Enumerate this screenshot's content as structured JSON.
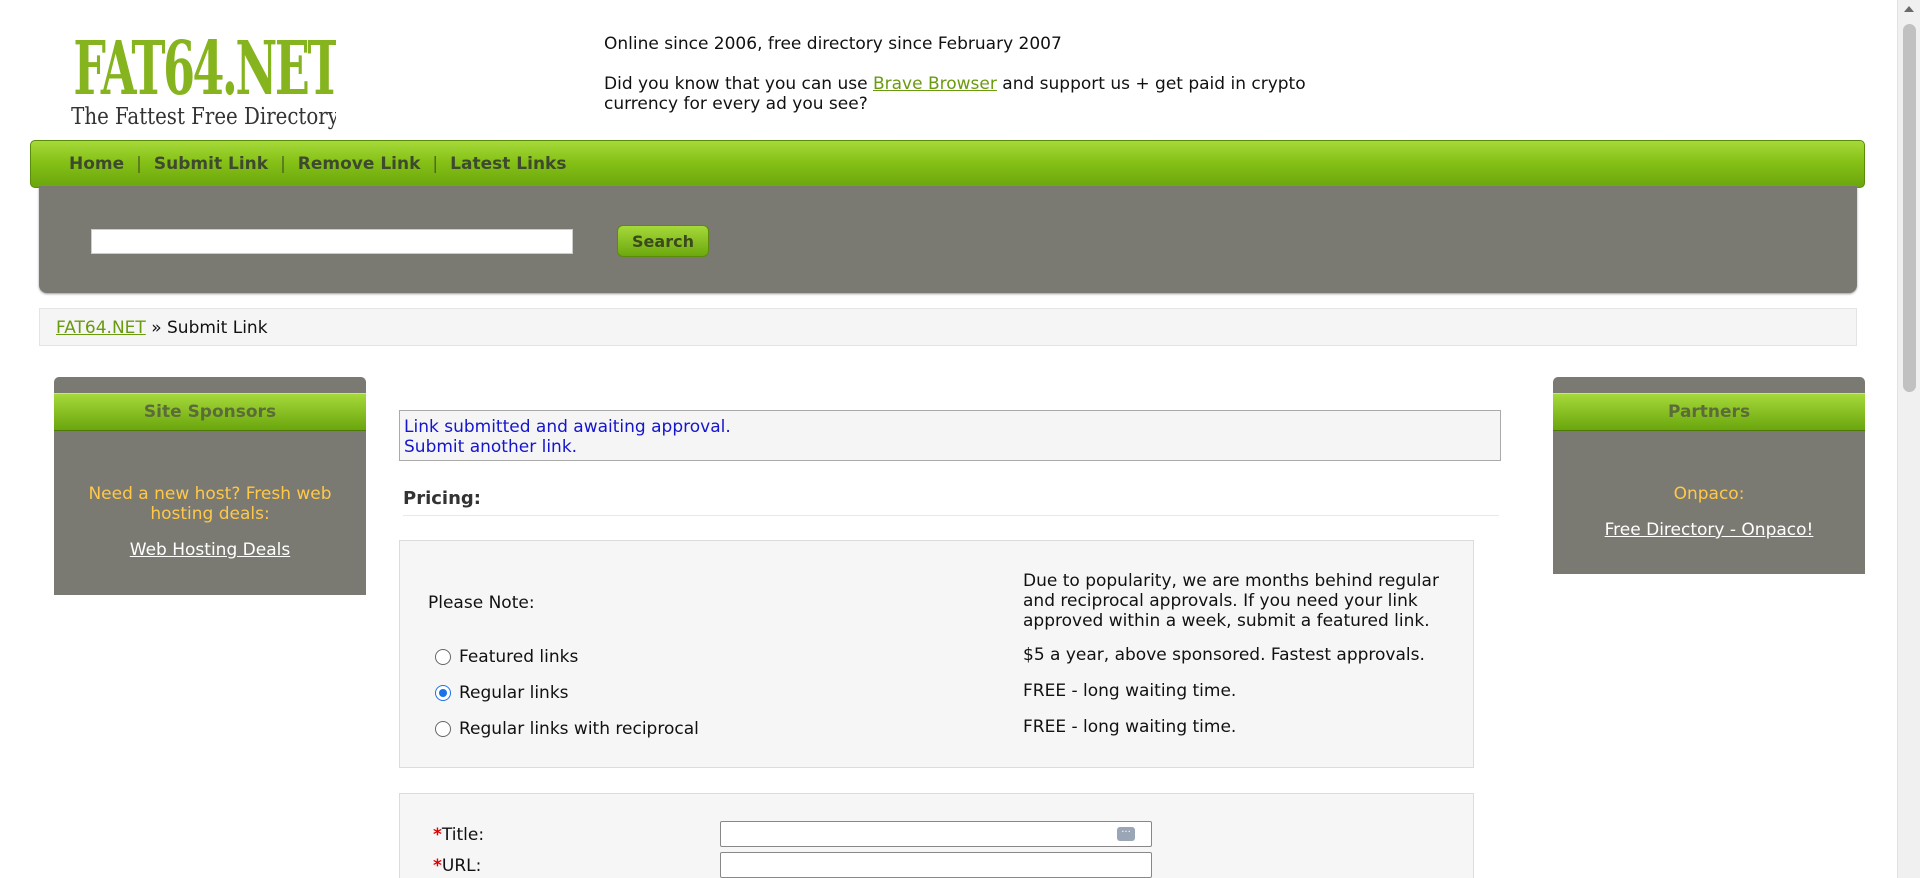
{
  "logo": {
    "text": "FAT64.NET",
    "tagline": "The Fattest Free Directory"
  },
  "header": {
    "line1": "Online since 2006, free directory since February 2007",
    "line2_before": "Did you know that you can use ",
    "line2_link": "Brave Browser",
    "line2_after": " and support us + get paid in crypto currency for every ad you see?"
  },
  "nav": {
    "items": [
      "Home",
      "Submit Link",
      "Remove Link",
      "Latest Links"
    ],
    "separator": "|"
  },
  "search": {
    "input_value": "",
    "button_label": "Search"
  },
  "breadcrumb": {
    "home": "FAT64.NET",
    "sep": " » ",
    "current": "Submit Link"
  },
  "sponsors": {
    "title": "Site Sponsors",
    "promo": "Need a new host? Fresh web hosting deals:",
    "link": "Web Hosting Deals"
  },
  "partners": {
    "title": "Partners",
    "promo": "Onpaco:",
    "link": "Free Directory - Onpaco!"
  },
  "notice": {
    "line1": "Link submitted and awaiting approval.",
    "line2": "Submit another link."
  },
  "pricing": {
    "title": "Pricing:",
    "please_note": "Please Note:",
    "note_text": "Due to popularity, we are months behind regular and reciprocal approvals. If you need your link approved within a week, submit a featured link.",
    "options": [
      {
        "label": "Featured links",
        "desc": "$5 a year, above sponsored. Fastest approvals.",
        "checked": false
      },
      {
        "label": "Regular links",
        "desc": "FREE - long waiting time.",
        "checked": true
      },
      {
        "label": "Regular links with reciprocal",
        "desc": "FREE - long waiting time.",
        "checked": false
      }
    ]
  },
  "form": {
    "required_mark": "*",
    "title_label": "Title:",
    "url_label": "URL:",
    "title_value": "",
    "url_value": "",
    "field_icon": "ellipsis-icon"
  },
  "colors": {
    "accent": "#86c117",
    "panel": "#7a7a72",
    "link": "#6a9a0f",
    "notice": "#1515cc",
    "promo": "#ffc84a"
  }
}
